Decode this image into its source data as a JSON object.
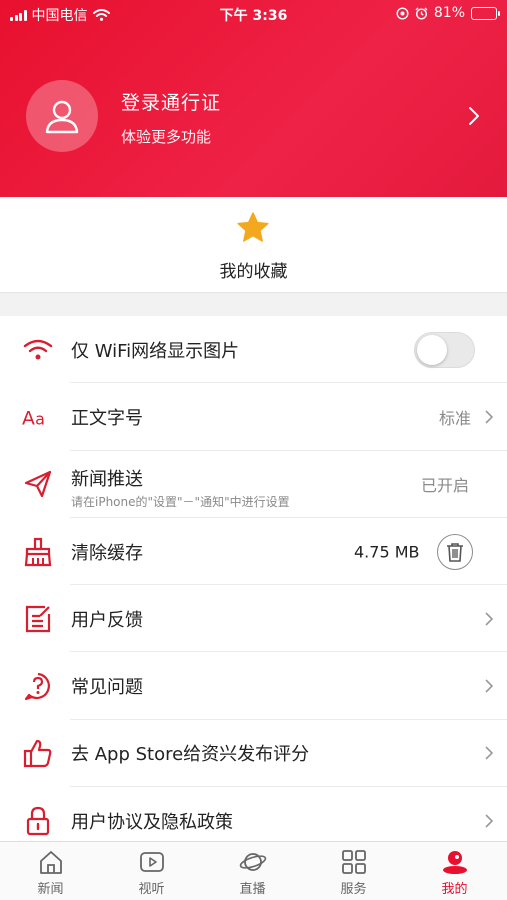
{
  "status_bar": {
    "carrier": "中国电信",
    "time": "下午 3:36",
    "battery_percent": "81%",
    "battery_level": 0.81
  },
  "profile": {
    "title": "登录通行证",
    "subtitle": "体验更多功能",
    "avatar_icon": "user-icon",
    "arrow_icon": "chevron-right-icon"
  },
  "favorites": {
    "label": "我的收藏",
    "icon": "star-icon"
  },
  "settings": {
    "wifi_images": {
      "label": "仅 WiFi网络显示图片",
      "icon": "wifi-icon",
      "enabled": false
    },
    "font_size": {
      "label": "正文字号",
      "icon": "font-size-icon",
      "value": "标准"
    },
    "push": {
      "label": "新闻推送",
      "sub": "请在iPhone的\"设置\"－\"通知\"中进行设置",
      "icon": "send-icon",
      "value": "已开启"
    },
    "cache": {
      "label": "清除缓存",
      "icon": "broom-icon",
      "value": "4.75 MB",
      "action_icon": "trash-icon"
    },
    "feedback": {
      "label": "用户反馈",
      "icon": "edit-icon"
    },
    "faq": {
      "label": "常见问题",
      "icon": "question-icon"
    },
    "rate": {
      "label": "去 App Store给资兴发布评分",
      "icon": "thumbs-up-icon"
    },
    "privacy": {
      "label": "用户协议及隐私政策",
      "icon": "lock-icon"
    }
  },
  "tabs": [
    {
      "label": "新闻",
      "icon": "home-icon",
      "active": false
    },
    {
      "label": "视听",
      "icon": "play-icon",
      "active": false
    },
    {
      "label": "直播",
      "icon": "planet-icon",
      "active": false
    },
    {
      "label": "服务",
      "icon": "grid-icon",
      "active": false
    },
    {
      "label": "我的",
      "icon": "profile-icon",
      "active": true
    }
  ],
  "colors": {
    "brand": "#e8102e",
    "icon_red": "#d81e2f",
    "muted": "#8a8a8a"
  }
}
